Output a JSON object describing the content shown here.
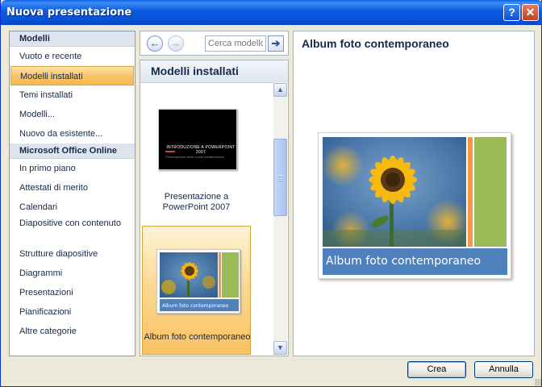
{
  "window": {
    "title": "Nuova presentazione",
    "help_button": "?",
    "close_button": "✕"
  },
  "sidebar": {
    "sections": [
      {
        "header": "Modelli"
      },
      {
        "header": "Microsoft Office Online"
      }
    ],
    "items_local": [
      {
        "label": "Vuoto e recente"
      },
      {
        "label": "Modelli installati",
        "selected": true
      },
      {
        "label": "Temi installati"
      },
      {
        "label": "Modelli..."
      },
      {
        "label": "Nuovo da esistente..."
      }
    ],
    "items_online": [
      {
        "label": "In primo piano"
      },
      {
        "label": "Attestati di merito"
      },
      {
        "label": "Calendari"
      },
      {
        "label": "Diapositive con contenuto"
      },
      {
        "label": "Strutture diapositive"
      },
      {
        "label": "Diagrammi"
      },
      {
        "label": "Presentazioni"
      },
      {
        "label": "Pianificazioni"
      },
      {
        "label": "Altre categorie"
      }
    ]
  },
  "nav": {
    "back_icon": "←",
    "forward_icon": "→",
    "search_placeholder": "Cerca modello",
    "search_go_icon": "➔"
  },
  "templates": {
    "header": "Modelli installati",
    "items": [
      {
        "caption": "Presentazione a PowerPoint 2007",
        "thumb_title": "INTRODUZIONE A POWERPOINT 2007",
        "thumb_sub": "Presentazione delle nuove caratteristiche"
      },
      {
        "caption": "Album foto contemporaneo",
        "thumb_caption": "Album foto contemporaneo",
        "selected": true
      }
    ]
  },
  "preview": {
    "title": "Album foto contemporaneo",
    "slide_caption": "Album foto contemporaneo"
  },
  "buttons": {
    "create": "Crea",
    "cancel": "Annulla"
  },
  "colors": {
    "titlebar": "#0a59e0",
    "selection": "#f9c46a",
    "slide_caption_bg": "#4f81bd",
    "slide_accent_orange": "#f79646",
    "slide_accent_green": "#9bbb59"
  }
}
